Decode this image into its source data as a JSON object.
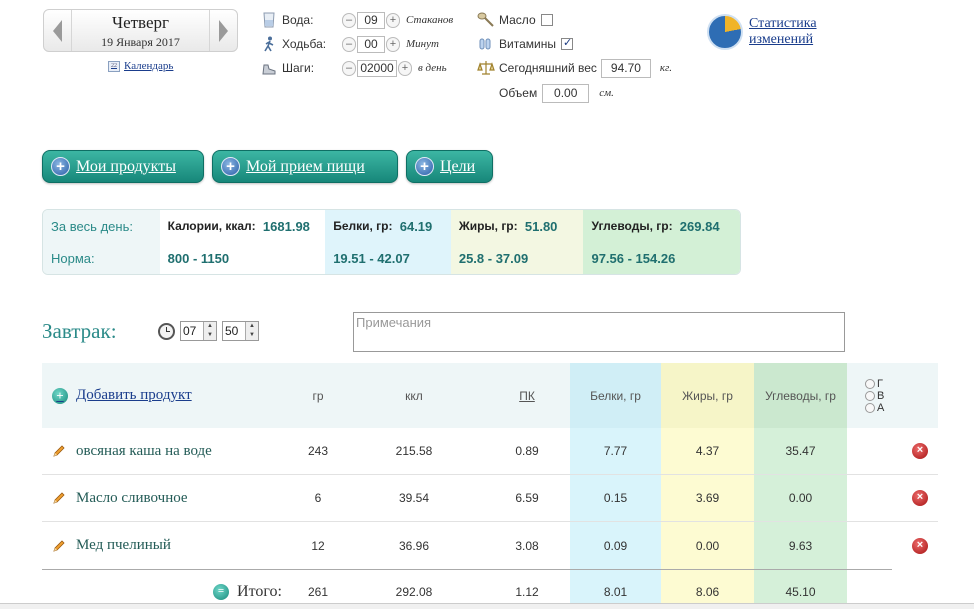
{
  "date": {
    "day_name": "Четверг",
    "date_text": "19 Января 2017",
    "calendar_link": "Календарь"
  },
  "trackers": [
    {
      "label": "Вода:",
      "value": "09",
      "unit": "Стаканов",
      "icon": "water-glass-icon"
    },
    {
      "label": "Ходьба:",
      "value": "00",
      "unit": "Минут",
      "icon": "walking-person-icon"
    },
    {
      "label": "Шаги:",
      "value": "02000",
      "unit": "в день",
      "icon": "shoe-icon"
    }
  ],
  "stepper_minus": "–",
  "stepper_plus": "+",
  "checks": {
    "oil": {
      "label": "Масло",
      "checked": false
    },
    "vitamins": {
      "label": "Витамины",
      "checked": true
    },
    "weight": {
      "label": "Сегодняшний вес",
      "value": "94.70",
      "unit": "кг."
    },
    "volume": {
      "label": "Объем",
      "value": "0.00",
      "unit": "см."
    }
  },
  "stats_link": {
    "line1": "Статистика",
    "line2": "изменений"
  },
  "buttons": {
    "my_products": "Мои продукты",
    "my_meal": "Мой прием пищи",
    "goals": "Цели",
    "plus": "+"
  },
  "summary": {
    "day_label": "За весь день:",
    "norm_label": "Норма:",
    "calories_label": "Калории, ккал:",
    "calories_value": "1681.98",
    "calories_norm": "800 - 1150",
    "protein_label": "Белки, гр:",
    "protein_value": "64.19",
    "protein_norm": "19.51 - 42.07",
    "fat_label": "Жиры, гр:",
    "fat_value": "51.80",
    "fat_norm": "25.8 - 37.09",
    "carbs_label": "Углеводы, гр:",
    "carbs_value": "269.84",
    "carbs_norm": "97.56 - 154.26"
  },
  "meal": {
    "title": "Завтрак:",
    "hour": "07",
    "minute": "50",
    "notes_placeholder": "Примечания"
  },
  "table": {
    "add_product": "Добавить продукт",
    "columns": {
      "gr": "гр",
      "kcal": "ккл",
      "pk": "ПК",
      "protein": "Белки, гр",
      "fat": "Жиры, гр",
      "carbs": "Углеводы, гр"
    },
    "radio_options": [
      "Г",
      "В",
      "А"
    ],
    "rows": [
      {
        "name": "овсяная каша на воде",
        "gr": "243",
        "kcal": "215.58",
        "pk": "0.89",
        "protein": "7.77",
        "fat": "4.37",
        "carbs": "35.47"
      },
      {
        "name": "Масло сливочное",
        "gr": "6",
        "kcal": "39.54",
        "pk": "6.59",
        "protein": "0.15",
        "fat": "3.69",
        "carbs": "0.00"
      },
      {
        "name": "Мед пчелиный",
        "gr": "12",
        "kcal": "36.96",
        "pk": "3.08",
        "protein": "0.09",
        "fat": "0.00",
        "carbs": "9.63"
      }
    ],
    "total": {
      "label": "Итого:",
      "gr": "261",
      "kcal": "292.08",
      "pk": "1.12",
      "protein": "8.01",
      "fat": "8.06",
      "carbs": "45.10"
    }
  },
  "colors": {
    "accent_teal": "#2a8a88",
    "button_green": "#17877a",
    "link_blue": "#1a3d8c",
    "protein_bg": "#d9f4fb",
    "fat_bg": "#fdfbd2",
    "carbs_bg": "#d5f0d9"
  }
}
